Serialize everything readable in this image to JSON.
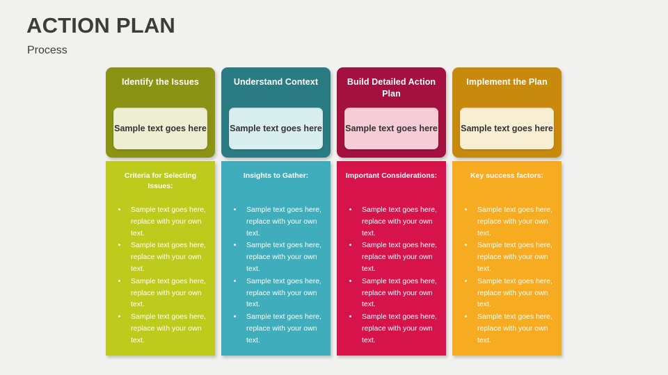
{
  "slide": {
    "background_color": "#f1f1f0",
    "title": "ACTION PLAN",
    "subtitle": "Process"
  },
  "columns": [
    {
      "header_color": "#8a9313",
      "header_title": "Identify the Issues",
      "inner_box_color": "#eeeed2",
      "inner_box_text": "Sample text goes here",
      "body_color": "#bfcb1c",
      "body_heading": "Criteria for Selecting Issues:",
      "bullets": [
        "Sample text goes here, replace with your own text.",
        "Sample text goes here, replace with your own text.",
        "Sample text goes here, replace with your own text.",
        "Sample text goes here, replace with your own text."
      ]
    },
    {
      "header_color": "#2b7b83",
      "header_title": "Understand Context",
      "inner_box_color": "#d9eeee",
      "inner_box_text": "Sample text goes here",
      "body_color": "#3fadbb",
      "body_heading": "Insights to Gather:",
      "bullets": [
        "Sample text goes here, replace with your own text.",
        "Sample text goes here, replace with your own text.",
        "Sample text goes here, replace with your own text.",
        "Sample text goes here, replace with your own text."
      ]
    },
    {
      "header_color": "#a4103f",
      "header_title": "Build Detailed Action Plan",
      "inner_box_color": "#f6ccd8",
      "inner_box_text": "Sample text goes here",
      "body_color": "#d6144b",
      "body_heading": "Important Considerations:",
      "bullets": [
        "Sample text goes here, replace with your own text.",
        "Sample text goes here, replace with your own text.",
        "Sample text goes here, replace with your own text.",
        "Sample text goes here, replace with your own text."
      ]
    },
    {
      "header_color": "#c88a0c",
      "header_title": "Implement the Plan",
      "inner_box_color": "#f7eed4",
      "inner_box_text": "Sample text goes here",
      "body_color": "#f7ab21",
      "body_heading": "Key success factors:",
      "bullets": [
        "Sample text goes here, replace with your own text.",
        "Sample text goes here, replace with your own text.",
        "Sample text goes here, replace with your own text.",
        "Sample text goes here, replace with your own text."
      ]
    }
  ]
}
